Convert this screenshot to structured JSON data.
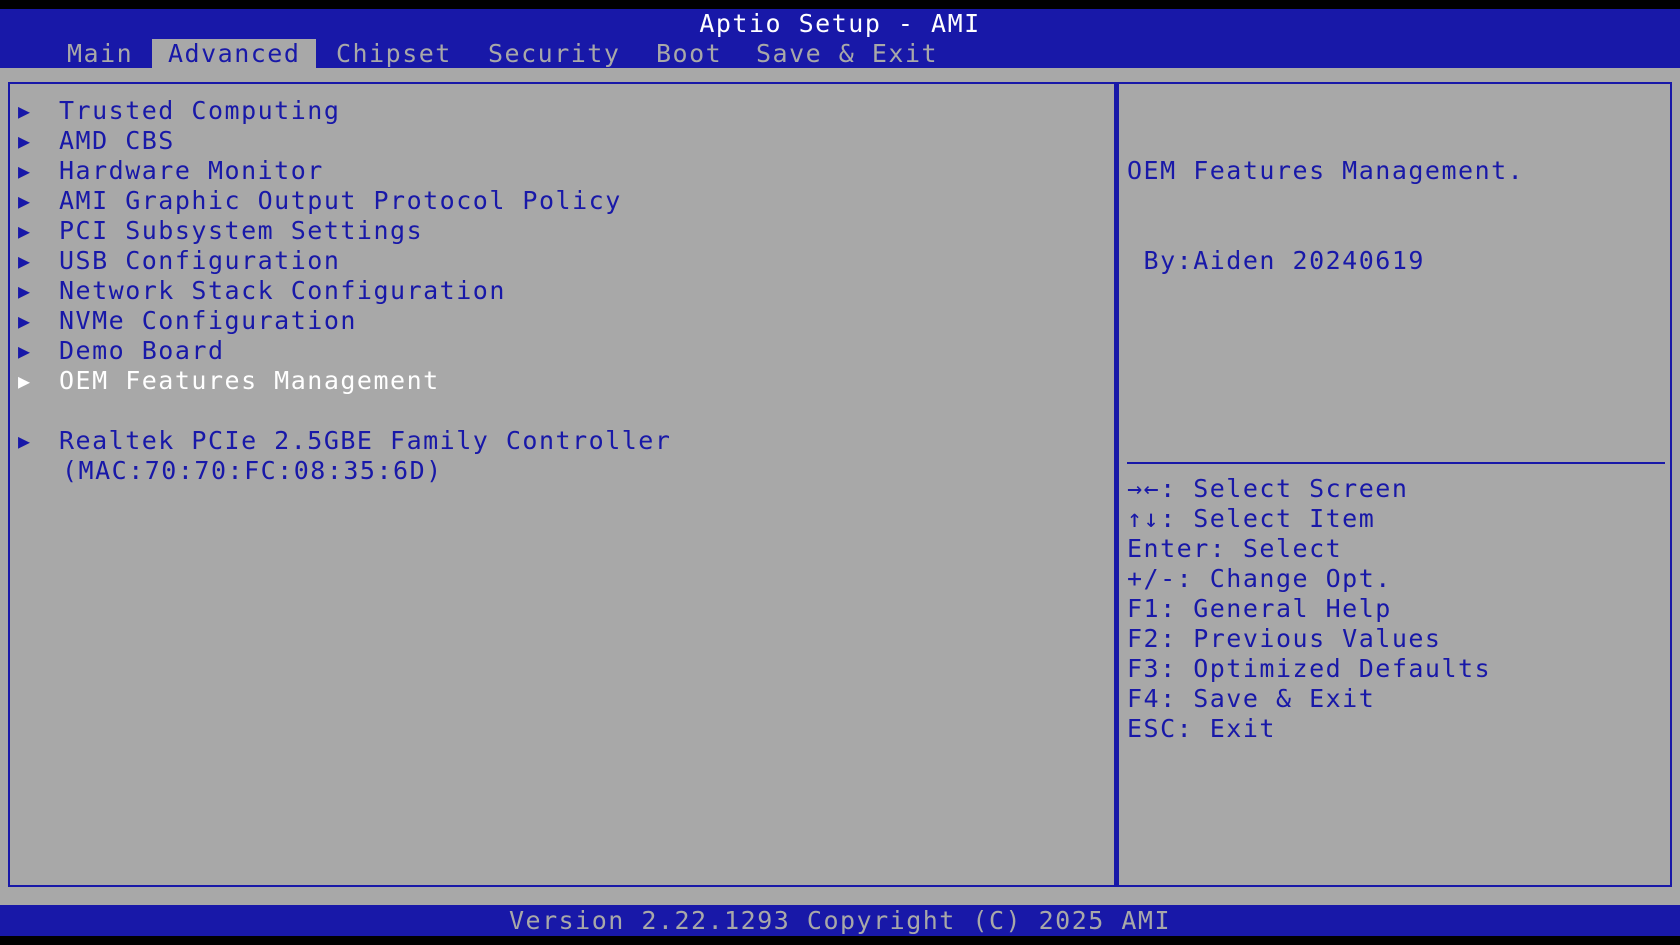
{
  "app": {
    "title": "Aptio Setup - AMI",
    "footer": "Version 2.22.1293 Copyright (C) 2025 AMI"
  },
  "tabs": [
    {
      "label": "Main",
      "active": false
    },
    {
      "label": "Advanced",
      "active": true
    },
    {
      "label": "Chipset",
      "active": false
    },
    {
      "label": "Security",
      "active": false
    },
    {
      "label": "Boot",
      "active": false
    },
    {
      "label": "Save & Exit",
      "active": false
    }
  ],
  "menu": {
    "arrow": "▶",
    "items": [
      {
        "label": "Trusted Computing"
      },
      {
        "label": "AMD CBS"
      },
      {
        "label": "Hardware Monitor"
      },
      {
        "label": "AMI Graphic Output Protocol Policy"
      },
      {
        "label": "PCI Subsystem Settings"
      },
      {
        "label": "USB Configuration"
      },
      {
        "label": "Network Stack Configuration"
      },
      {
        "label": "NVMe Configuration"
      },
      {
        "label": "Demo Board"
      },
      {
        "label": "OEM Features Management",
        "selected": true
      },
      {
        "label": "Realtek PCIe 2.5GBE Family Controller"
      }
    ],
    "realtek_mac": "(MAC:70:70:FC:08:35:6D)"
  },
  "help": {
    "line1": "OEM Features Management.",
    "line2": " By:Aiden 20240619"
  },
  "keys": [
    "→←: Select Screen",
    "↑↓: Select Item",
    "Enter: Select",
    "+/-: Change Opt.",
    "F1: General Help",
    "F2: Previous Values",
    "F3: Optimized Defaults",
    "F4: Save & Exit",
    "ESC: Exit"
  ],
  "colors": {
    "bios_blue": "#1818a8",
    "bios_gray": "#a8a8a8",
    "highlight": "#ffffff"
  }
}
